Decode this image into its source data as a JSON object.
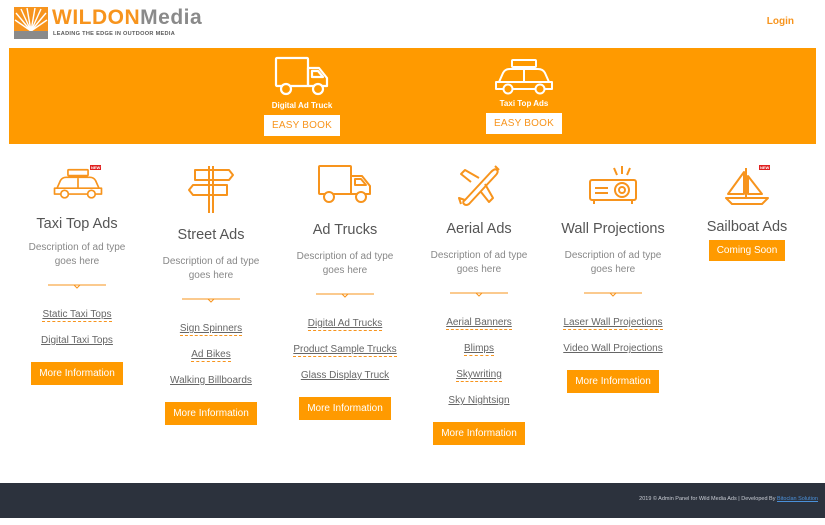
{
  "header": {
    "logo_word_1": "WILD",
    "logo_word_2": "ON",
    "logo_word_3": "Media",
    "tagline": "LEADING THE EDGE IN OUTDOOR MEDIA",
    "login_label": "Login"
  },
  "banner": {
    "items": [
      {
        "label": "Digital Ad Truck",
        "button": "EASY BOOK",
        "icon": "truck-icon"
      },
      {
        "label": "Taxi Top Ads",
        "button": "EASY BOOK",
        "icon": "taxi-icon"
      }
    ]
  },
  "columns": [
    {
      "title": "Taxi Top Ads",
      "description": "Description of ad type goes here",
      "links": [
        "Static Taxi Tops",
        "Digital Taxi Tops"
      ],
      "button": "More Information",
      "icon": "taxi-icon",
      "badge": "NEW"
    },
    {
      "title": "Street Ads",
      "description": "Description of ad type goes here",
      "links": [
        "Sign Spinners",
        "Ad Bikes",
        "Walking Billboards"
      ],
      "button": "More Information",
      "icon": "signpost-icon"
    },
    {
      "title": "Ad Trucks",
      "description": "Description of ad type goes here",
      "links": [
        "Digital Ad Trucks",
        "Product Sample Trucks",
        "Glass Display Truck"
      ],
      "button": "More Information",
      "icon": "truck-icon"
    },
    {
      "title": "Aerial Ads",
      "description": "Description of ad type goes here",
      "links": [
        "Aerial Banners",
        "Blimps",
        "Skywriting",
        "Sky Nightsign"
      ],
      "button": "More Information",
      "icon": "airplane-icon"
    },
    {
      "title": "Wall Projections",
      "description": "Description of ad type goes here",
      "links": [
        "Laser Wall Projections",
        "Video Wall Projections"
      ],
      "button": "More Information",
      "icon": "projector-icon"
    },
    {
      "title": "Sailboat Ads",
      "button": "Coming Soon",
      "icon": "sailboat-icon",
      "badge": "NEW"
    }
  ],
  "footer": {
    "text": "2019 © Admin Panel for Wild Media Ads  |  Developed By ",
    "developer": "Bitoclan Solution"
  },
  "colors": {
    "accent": "#ff9a00",
    "footer_bg": "#2c323d",
    "link_underline": "#f7941d"
  }
}
